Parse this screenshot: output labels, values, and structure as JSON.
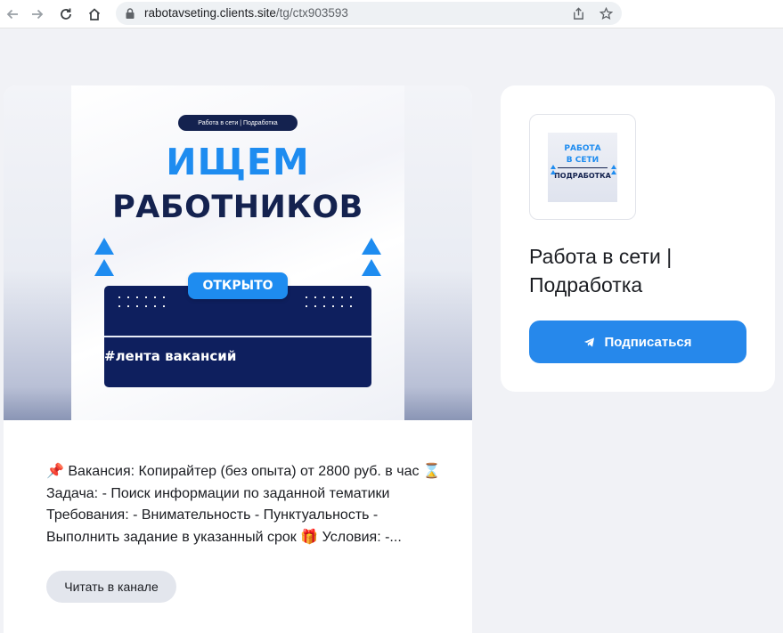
{
  "browser": {
    "url_host": "rabotavseting.clients.site",
    "url_path": "/tg/ctx903593"
  },
  "post": {
    "image": {
      "pill": "Работа в сети | Подработка",
      "title_line1": "ИЩЕМ",
      "title_line2": "РАБОТНИКОВ",
      "badge": "ОТКРЫТО",
      "tag": "#лента вакансий"
    },
    "text_lines": [
      "📌 Вакансия: Копирайтер (без опыта) от 2800 руб. в час ⌛",
      "Задача: - Поиск информации по заданной тематики",
      "Требования: - Внимательность - Пунктуальность -",
      "Выполнить задание в указанный срок 🎁 Условия: -..."
    ],
    "read_button": "Читать в канале"
  },
  "channel": {
    "logo": {
      "line1": "РАБОТА",
      "line2": "В СЕТИ",
      "line3": "ПОДРАБОТКА"
    },
    "name": "Работа в сети | Подработка",
    "subscribe_button": "Подписаться"
  },
  "colors": {
    "accent": "#2688eb",
    "brand_blue": "#1e8cf0",
    "brand_navy": "#14224f",
    "page_background": "#f1f2f6"
  }
}
